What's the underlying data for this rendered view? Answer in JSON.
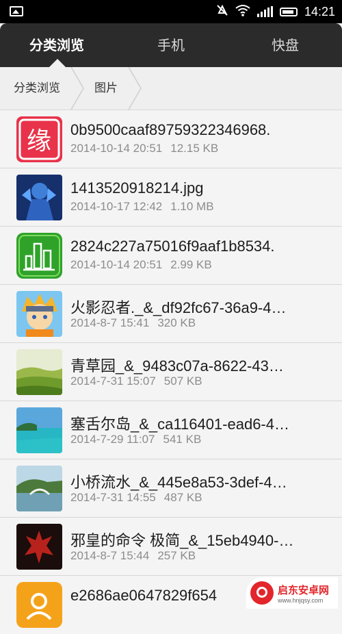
{
  "status_bar": {
    "time": "14:21",
    "left_icon": "image-notification-icon",
    "right_icons": [
      "mute-icon",
      "wifi-icon",
      "signal-icon",
      "battery-icon"
    ]
  },
  "tabs": [
    {
      "label": "分类浏览",
      "active": true
    },
    {
      "label": "手机",
      "active": false
    },
    {
      "label": "快盘",
      "active": false
    }
  ],
  "breadcrumb": [
    "分类浏览",
    "图片"
  ],
  "files": [
    {
      "name": "0b9500caaf89759322346968.",
      "date": "2014-10-14 20:51",
      "size": "12.15 KB",
      "thumb": "red-app-icon"
    },
    {
      "name": "1413520918214.jpg",
      "date": "2014-10-17 12:42",
      "size": "1.10 MB",
      "thumb": "blue-warrior-image"
    },
    {
      "name": "2824c227a75016f9aaf1b8534.",
      "date": "2014-10-14 20:51",
      "size": "2.99 KB",
      "thumb": "green-city-icon"
    },
    {
      "name": "火影忍者._&_df92fc67-36a9-4…",
      "date": "2014-8-7 15:41",
      "size": "320 KB",
      "thumb": "naruto-image"
    },
    {
      "name": "青草园_&_9483c07a-8622-43…",
      "date": "2014-7-31 15:07",
      "size": "507 KB",
      "thumb": "grass-hills-image"
    },
    {
      "name": "塞舌尔岛_&_ca116401-ead6-4…",
      "date": "2014-7-29 11:07",
      "size": "541 KB",
      "thumb": "seychelles-beach-image"
    },
    {
      "name": "小桥流水_&_445e8a53-3def-4…",
      "date": "2014-7-31 14:55",
      "size": "487 KB",
      "thumb": "bridge-river-image"
    },
    {
      "name": "邪皇的命令  极简_&_15eb4940-…",
      "date": "2014-8-7 15:44",
      "size": "257 KB",
      "thumb": "horde-emblem-image"
    },
    {
      "name": "e2686ae0647829f654",
      "date": "",
      "size": "",
      "thumb": "orange-app-icon"
    }
  ],
  "watermark": {
    "cn": "启东安卓网",
    "en": "www.hnjqsy.com"
  }
}
